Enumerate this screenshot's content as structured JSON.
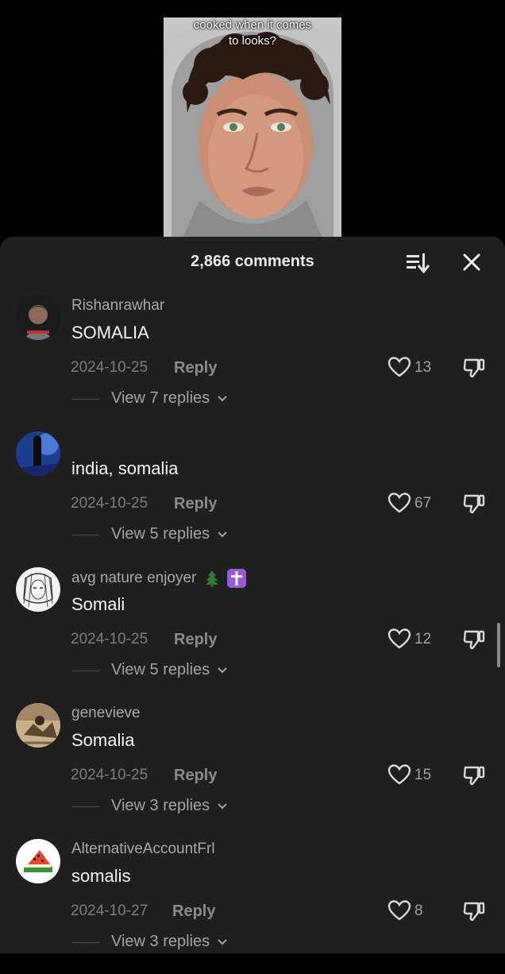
{
  "video": {
    "caption_line1": "cooked when it comes",
    "caption_line2": "to looks?"
  },
  "sheet": {
    "title": "2,866 comments",
    "sort_icon": "sort-icon",
    "close_icon": "close-icon"
  },
  "comments": [
    {
      "username": "Rishanrawhar",
      "text": "SOMALIA",
      "date": "2024-10-25",
      "reply_label": "Reply",
      "likes": "13",
      "replies_label": "View 7 replies",
      "avatar_color": "#2a2a2a"
    },
    {
      "username": "",
      "text": "india, somalia",
      "date": "2024-10-25",
      "reply_label": "Reply",
      "likes": "67",
      "replies_label": "View 5 replies",
      "avatar_color": "#2d4f9e"
    },
    {
      "username": "avg nature enjoyer",
      "text": "Somali",
      "date": "2024-10-25",
      "reply_label": "Reply",
      "likes": "12",
      "replies_label": "View 5 replies",
      "avatar_color": "#e8e8e8",
      "emojis": [
        "evergreen-tree-emoji",
        "latin-cross-emoji"
      ]
    },
    {
      "username": "genevieve",
      "text": "Somalia",
      "date": "2024-10-25",
      "reply_label": "Reply",
      "likes": "15",
      "replies_label": "View 3 replies",
      "avatar_color": "#b39a7a"
    },
    {
      "username": "AlternativeAccountFrl",
      "text": "somalis",
      "date": "2024-10-27",
      "reply_label": "Reply",
      "likes": "8",
      "replies_label": "View 3 replies",
      "avatar_color": "#ffffff"
    }
  ],
  "colors": {
    "sheet_bg": "#1f1f1f",
    "accent_purple": "#9b59d6",
    "tree_green": "#2e7d32"
  }
}
